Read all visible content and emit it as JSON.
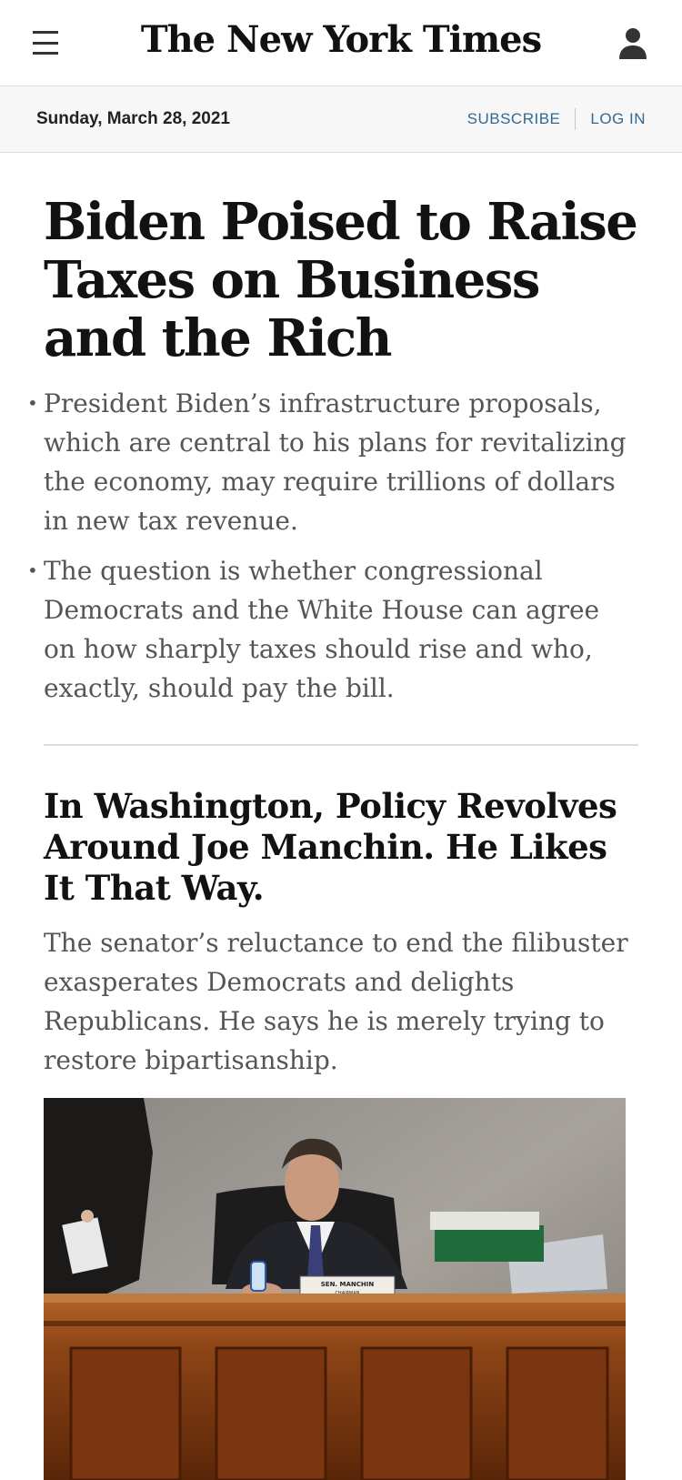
{
  "header": {
    "logo_text": "The New York Times",
    "menu_icon": "hamburger-menu-icon",
    "account_icon": "user-account-icon"
  },
  "datebar": {
    "date": "Sunday, March 28, 2021",
    "subscribe_label": "SUBSCRIBE",
    "login_label": "LOG IN",
    "link_color": "#326891"
  },
  "stories": {
    "lead": {
      "headline": "Biden Poised to Raise Taxes on Business and the Rich",
      "bullets": [
        "President Biden’s infrastructure proposals, which are central to his plans for revitalizing the economy, may require trillions of dollars in new tax revenue.",
        "The question is whether congressional Democrats and the White House can agree on how sharply taxes should rise and who, exactly, should pay the bill."
      ]
    },
    "second": {
      "headline": "In Washington, Policy Revolves Around Joe Manchin. He Likes It That Way.",
      "summary": "The senator’s reluctance to end the filibuster exasperates Democrats and delights Republicans. He says he is merely trying to restore bipartisanship.",
      "image": {
        "nameplate_line1": "SEN. MANCHIN",
        "nameplate_line2": "CHAIRMAN"
      }
    }
  }
}
